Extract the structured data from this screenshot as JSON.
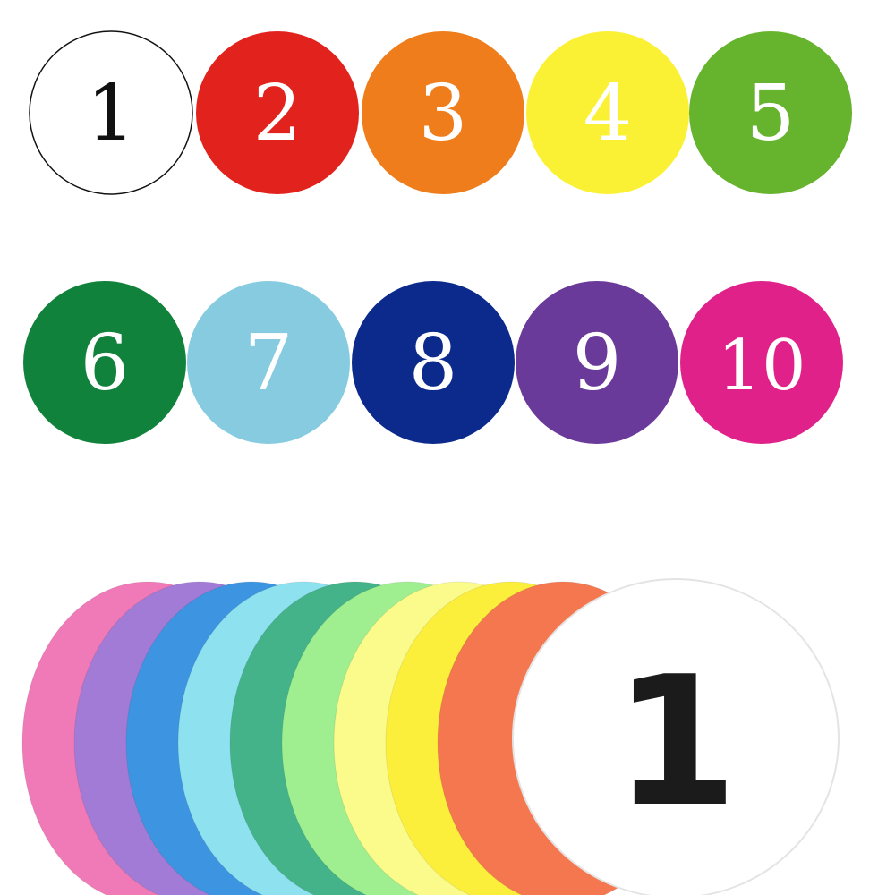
{
  "spots": [
    {
      "label": "1",
      "fill": "#ffffff",
      "text_color": "#111111",
      "outline": "#111111"
    },
    {
      "label": "2",
      "fill": "#e2231d",
      "text_color": "#ffffff"
    },
    {
      "label": "3",
      "fill": "#f07d1b",
      "text_color": "#ffffff"
    },
    {
      "label": "4",
      "fill": "#fbf134",
      "text_color": "#ffffff"
    },
    {
      "label": "5",
      "fill": "#66b32e",
      "text_color": "#ffffff"
    },
    {
      "label": "6",
      "fill": "#11823b",
      "text_color": "#ffffff"
    },
    {
      "label": "7",
      "fill": "#86cbe0",
      "text_color": "#ffffff"
    },
    {
      "label": "8",
      "fill": "#0b2a8c",
      "text_color": "#ffffff"
    },
    {
      "label": "9",
      "fill": "#6a3a9a",
      "text_color": "#ffffff"
    },
    {
      "label": "10",
      "fill": "#e0218a",
      "text_color": "#ffffff"
    }
  ],
  "stack": {
    "discs_back_to_front": [
      {
        "fill": "#f07ab7"
      },
      {
        "fill": "#a27bd6"
      },
      {
        "fill": "#3d95e2"
      },
      {
        "fill": "#8ee1ef"
      },
      {
        "fill": "#45b38a"
      },
      {
        "fill": "#9fef90"
      },
      {
        "fill": "#fbfb8c"
      },
      {
        "fill": "#fcef3c"
      },
      {
        "fill": "#f5774f"
      }
    ],
    "front_disc": {
      "label": "1",
      "fill": "#ffffff",
      "text_color": "#1b1b1b"
    }
  }
}
